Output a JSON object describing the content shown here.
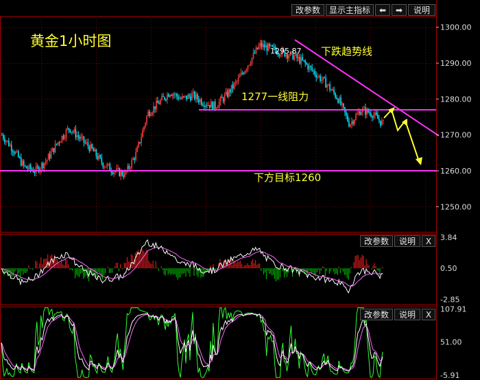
{
  "toolbar": {
    "modify_params": "改参数",
    "show_main_indicator": "显示主指标",
    "prev_arrow": "⬅",
    "next_arrow": "➡",
    "help": "说明"
  },
  "sub_toolbar": {
    "modify_params": "改参数",
    "help": "说明",
    "close": "X"
  },
  "annotations": {
    "title": "黄金1小时图",
    "trend_label": "下跌趋势线",
    "resistance_label": "1277一线阻力",
    "target_label": "下方目标1260",
    "high_price": "1295.87"
  },
  "colors": {
    "up": "#ff3b3b",
    "down": "#00e5ff",
    "trendline": "#ff33ff",
    "annotation": "#ffff33",
    "grid": "#7a0000",
    "axis": "#aa0000",
    "macd_neg": "#00cc00",
    "macd_pos": "#ff2020",
    "k_line": "#ffffff",
    "d_line": "#ff66ff",
    "j_line": "#33ff33"
  },
  "chart_data": [
    {
      "type": "candlestick",
      "title": "黄金1小时图",
      "ylim": [
        1243,
        1303
      ],
      "y_ticks": [
        1300,
        1290,
        1280,
        1270,
        1260,
        1250
      ],
      "y_tick_labels": [
        "1300.00",
        "1290.00",
        "1280.00",
        "1270.00",
        "1260.00",
        "1250.00"
      ],
      "path_points": [
        1270,
        1266,
        1261,
        1260,
        1263,
        1268,
        1272,
        1269,
        1266,
        1262,
        1260,
        1259,
        1265,
        1276,
        1279,
        1282,
        1280,
        1281,
        1279,
        1278,
        1281,
        1285,
        1290,
        1295,
        1294,
        1293,
        1292,
        1290,
        1287,
        1284,
        1280,
        1273,
        1277,
        1276,
        1273
      ],
      "high_label_value": 1295.87,
      "resistance_level": 1277,
      "target_level": 1260
    },
    {
      "type": "macd",
      "ylim": [
        -3.4,
        4.2
      ],
      "y_tick_labels": [
        "3.84",
        "0.50",
        "-2.85"
      ],
      "y_ticks": [
        3.84,
        0.5,
        -2.85
      ]
    },
    {
      "type": "kdj",
      "ylim": [
        -12,
        112
      ],
      "y_tick_labels": [
        "107.91",
        "51.00",
        "-5.91"
      ],
      "y_ticks": [
        107.91,
        51.0,
        -5.91
      ]
    }
  ]
}
